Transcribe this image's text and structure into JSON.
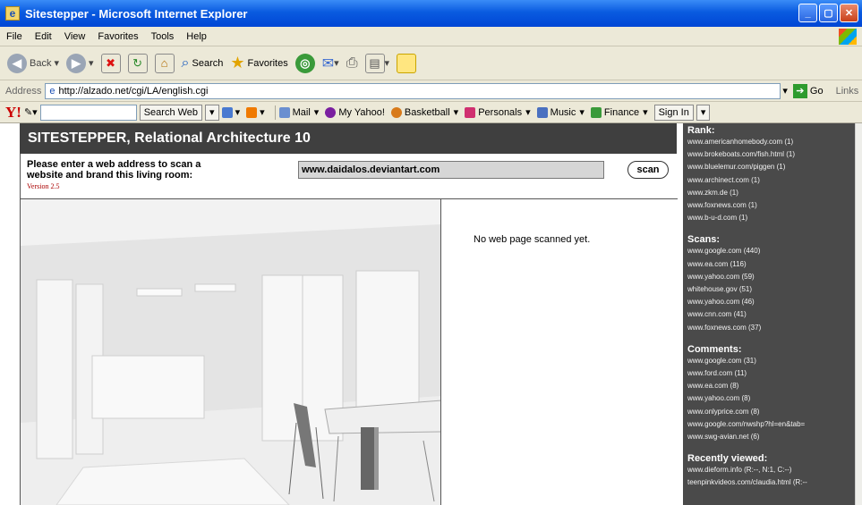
{
  "window": {
    "title": "Sitestepper - Microsoft Internet Explorer"
  },
  "menu": [
    "File",
    "Edit",
    "View",
    "Favorites",
    "Tools",
    "Help"
  ],
  "toolbar": {
    "back_label": "Back",
    "search_label": "Search",
    "favorites_label": "Favorites"
  },
  "address": {
    "label": "Address",
    "url": "http://alzado.net/cgi/LA/english.cgi",
    "go_label": "Go",
    "links_label": "Links"
  },
  "yahoo": {
    "search_button": "Search Web",
    "items": [
      "Mail",
      "My Yahoo!",
      "Basketball",
      "Personals",
      "Music",
      "Finance"
    ],
    "signin": "Sign In"
  },
  "site": {
    "title": "SITESTEPPER, Relational Architecture 10",
    "prompt": "Please enter a web address to scan a website and brand this living room:",
    "version": "Version 2.5",
    "url_value": "www.daidalos.deviantart.com",
    "scan_label": "scan",
    "status": "No web page scanned yet."
  },
  "sidebar": {
    "rank_title": "Rank:",
    "rank": [
      "www.americanhomebody.com (1)",
      "www.brokeboats.com/fish.html (1)",
      "www.bluelemur.com/piggen (1)",
      "www.archinect.com (1)",
      "www.zkm.de (1)",
      "www.foxnews.com (1)",
      "www.b-u-d.com (1)"
    ],
    "scans_title": "Scans:",
    "scans": [
      "www.google.com (440)",
      "www.ea.com (116)",
      "www.yahoo.com (59)",
      "whitehouse.gov (51)",
      "www.yahoo.com (46)",
      "www.cnn.com (41)",
      "www.foxnews.com (37)"
    ],
    "comments_title": "Comments:",
    "comments": [
      "www.google.com (31)",
      "www.ford.com (11)",
      "www.ea.com (8)",
      "www.yahoo.com (8)",
      "www.onlyprice.com (8)",
      "www.google.com/nwshp?hl=en&tab=",
      "www.swg-avian.net (6)"
    ],
    "recent_title": "Recently viewed:",
    "recent": [
      "www.dieform.info (R:--, N:1, C:--)",
      "teenpinkvideos.com/claudia.html (R:--"
    ]
  }
}
